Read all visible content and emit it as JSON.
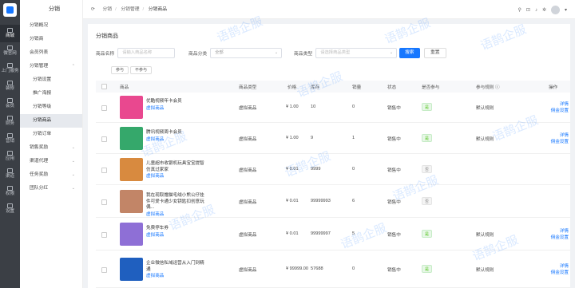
{
  "rail": [
    {
      "label": "商城",
      "icon": "shop-icon"
    },
    {
      "label": "微官网",
      "icon": "website-icon"
    },
    {
      "label": "上门服务",
      "icon": "service-icon"
    },
    {
      "label": "装修",
      "icon": "decorate-icon"
    },
    {
      "label": "会员",
      "icon": "member-icon"
    },
    {
      "label": "财务",
      "icon": "finance-icon"
    },
    {
      "label": "营销",
      "icon": "marketing-icon"
    },
    {
      "label": "应用",
      "icon": "apps-icon"
    },
    {
      "label": "渠道",
      "icon": "channel-icon"
    },
    {
      "label": "权限",
      "icon": "permission-icon"
    },
    {
      "label": "设置",
      "icon": "settings-icon"
    }
  ],
  "sidebar": {
    "title": "分销",
    "items": [
      {
        "label": "分销概况"
      },
      {
        "label": "分销商"
      },
      {
        "label": "会员列表"
      },
      {
        "label": "分销管理",
        "expanded": true
      },
      {
        "label": "分销设置",
        "sub": true
      },
      {
        "label": "推广海报",
        "sub": true
      },
      {
        "label": "分销等级",
        "sub": true
      },
      {
        "label": "分销商品",
        "sub": true,
        "active": true
      },
      {
        "label": "分销订单",
        "sub": true
      },
      {
        "label": "销售奖励",
        "collapsed": true
      },
      {
        "label": "渠道代理",
        "collapsed": true
      },
      {
        "label": "任务奖励",
        "collapsed": true
      },
      {
        "label": "团队分红",
        "collapsed": true
      }
    ]
  },
  "breadcrumb": [
    "分销",
    "分销管理",
    "分销商品"
  ],
  "page": {
    "title": "分销商品"
  },
  "filters": {
    "name_label": "商品名称",
    "name_placeholder": "请输入商品名称",
    "category_label": "商品分类",
    "category_value": "全部",
    "type_label": "商品类型",
    "type_placeholder": "请选择商品类型",
    "search": "搜索",
    "reset": "重置"
  },
  "tabs": [
    "参与",
    "不参与"
  ],
  "table": {
    "headers": [
      "商品",
      "商品类型",
      "价格",
      "库存",
      "销量",
      "状态",
      "是否参与",
      "参与规则",
      "操作"
    ],
    "rows": [
      {
        "name": "优酷视频年卡会员",
        "variant": "虚拟商品",
        "type": "虚拟商品",
        "price": "¥ 1.00",
        "stock": "10",
        "sales": "0",
        "status": "销售中",
        "joined": "是",
        "rule": "默认规则",
        "actions": [
          "详情",
          "佣金设置"
        ],
        "thumb": "#e9488f"
      },
      {
        "name": "腾讯视频周卡会员",
        "variant": "虚拟商品",
        "type": "虚拟商品",
        "price": "¥ 1.00",
        "stock": "9",
        "sales": "1",
        "status": "销售中",
        "joined": "是",
        "rule": "默认规则",
        "actions": [
          "详情",
          "佣金设置"
        ],
        "thumb": "#35a86b"
      },
      {
        "name": "儿童超市收银机玩具宝宝提智仿真过家家",
        "variant": "虚拟商品",
        "type": "虚拟商品",
        "price": "¥ 0.01",
        "stock": "9999",
        "sales": "0",
        "status": "销售中",
        "joined": "否",
        "rule": "",
        "actions": [],
        "thumb": "#d88a3f"
      },
      {
        "name": "我在现取撸猫毛绒小熊公仔挂件可爱卡通少女钥匙扣创意玩偶...",
        "variant": "虚拟商品",
        "type": "虚拟商品",
        "price": "¥ 0.01",
        "stock": "99999993",
        "sales": "6",
        "status": "销售中",
        "joined": "否",
        "rule": "",
        "actions": [],
        "thumb": "#c28567"
      },
      {
        "name": "免费停车券",
        "variant": "虚拟商品",
        "type": "虚拟商品",
        "price": "¥ 0.01",
        "stock": "99999997",
        "sales": "5",
        "status": "销售中",
        "joined": "是",
        "rule": "默认规则",
        "actions": [
          "详情",
          "佣金设置"
        ],
        "thumb": "#8e6fd6"
      },
      {
        "name": "企业微信私域运营从入门到精通",
        "variant": "虚拟商品",
        "type": "虚拟商品",
        "price": "¥ 99999.00",
        "stock": "57688",
        "sales": "0",
        "status": "销售中",
        "joined": "是",
        "rule": "默认规则",
        "actions": [
          "详情",
          "佣金设置"
        ],
        "thumb": "#1f5fbf"
      }
    ]
  },
  "watermark": "语鹊企服",
  "colors": {
    "primary": "#1677ff",
    "rail": "#3b3f45",
    "success": "#52c41a"
  }
}
